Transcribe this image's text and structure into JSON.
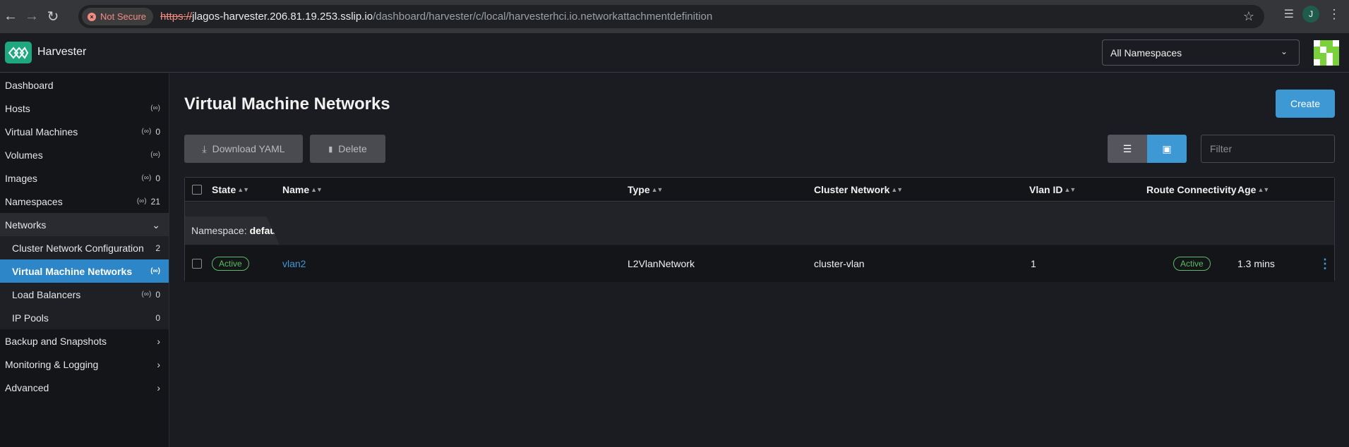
{
  "browser": {
    "security_label": "Not Secure",
    "url_scheme": "https://",
    "url_host": "jlagos-harvester.206.81.19.253.sslip.io",
    "url_path": "/dashboard/harvester/c/local/harvesterhci.io.networkattachmentdefinition",
    "profile_initial": "J"
  },
  "header": {
    "brand": "Harvester",
    "namespace_select": "All Namespaces"
  },
  "sidebar": {
    "items": [
      {
        "label": "Dashboard"
      },
      {
        "label": "Hosts",
        "count": ""
      },
      {
        "label": "Virtual Machines",
        "count": "0"
      },
      {
        "label": "Volumes",
        "count": ""
      },
      {
        "label": "Images",
        "count": "0"
      },
      {
        "label": "Namespaces",
        "count": "21"
      },
      {
        "label": "Networks"
      },
      {
        "label": "Cluster Network Configuration",
        "count": "2"
      },
      {
        "label": "Virtual Machine Networks",
        "count": ""
      },
      {
        "label": "Load Balancers",
        "count": "0"
      },
      {
        "label": "IP Pools",
        "count": "0"
      },
      {
        "label": "Backup and Snapshots"
      },
      {
        "label": "Monitoring & Logging"
      },
      {
        "label": "Advanced"
      }
    ]
  },
  "main": {
    "title": "Virtual Machine Networks",
    "create_label": "Create",
    "download_label": "Download YAML",
    "delete_label": "Delete",
    "filter_placeholder": "Filter"
  },
  "table": {
    "columns": [
      "State",
      "Name",
      "Type",
      "Cluster Network",
      "Vlan ID",
      "Route Connectivity",
      "Age"
    ],
    "group_label": "Namespace:",
    "group_value": "default",
    "rows": [
      {
        "state": "Active",
        "name": "vlan2",
        "type": "L2VlanNetwork",
        "cluster_network": "cluster-vlan",
        "vlan_id": "1",
        "route_connectivity": "Active",
        "age": "1.3 mins"
      }
    ]
  },
  "colors": {
    "accent": "#3d98d3",
    "brand_green": "#1fa87f",
    "status_active": "#5dbb63"
  }
}
